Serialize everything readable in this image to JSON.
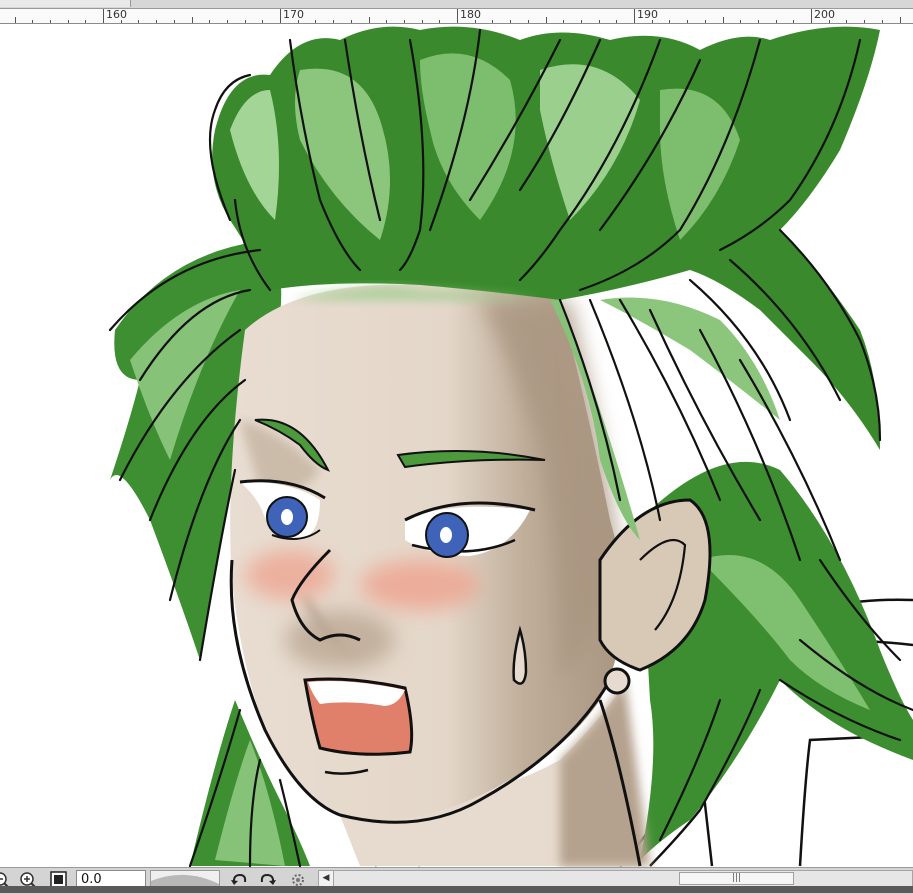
{
  "ruler": {
    "labels": [
      "160",
      "170",
      "180",
      "190",
      "200"
    ]
  },
  "statusbar": {
    "zoom_out_icon": "zoom-out-icon",
    "zoom_in_icon": "zoom-in-icon",
    "fit_icon": "fit-to-window-icon",
    "zoom_value": "0.0",
    "rotate_left_icon": "rotate-left-icon",
    "rotate_right_icon": "rotate-right-icon",
    "reset_rotation_icon": "reset-rotation-icon",
    "scroll_left_icon": "scroll-left-icon",
    "scroll_thumb_grip": "|||"
  },
  "colors": {
    "hair_dark": "#2f7d22",
    "hair_mid": "#4c9a3c",
    "hair_light": "#8cc67d",
    "skin_light": "#e7dccf",
    "skin_shadow": "#b8a590",
    "blush": "#eea592",
    "iris": "#3f63b9",
    "mouth": "#e0806a",
    "line": "#111111"
  }
}
